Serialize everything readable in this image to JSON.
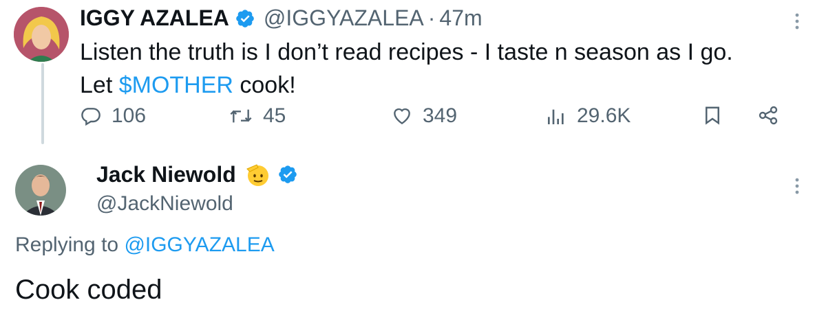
{
  "tweet": {
    "author_name": "IGGY AZALEA",
    "handle": "@IGGYAZALEA",
    "separator": "·",
    "time": "47m",
    "text_line1": "Listen the truth is I don’t read recipes - I taste n season as I go.",
    "text_line2_before": "Let ",
    "text_line2_link": "$MOTHER",
    "text_line2_after": " cook!",
    "stats": {
      "replies": "106",
      "retweets": "45",
      "likes": "349",
      "views": "29.6K"
    }
  },
  "reply": {
    "author_name": "Jack Niewold",
    "handle": "@JackNiewold",
    "replying_prefix": "Replying to ",
    "replying_handle": "@IGGYAZALEA",
    "text": "Cook coded"
  },
  "icons": {
    "reply": "speech-bubble-icon",
    "retweet": "retweet-icon",
    "like": "heart-icon",
    "views": "bar-chart-icon",
    "bookmark": "bookmark-icon",
    "share": "share-icon",
    "more": "more-vertical-icon",
    "verified": "verified-badge-icon",
    "emoji": "saluting-face-emoji"
  },
  "colors": {
    "link": "#1d9bf0",
    "secondary_text": "#536471",
    "verified": "#1d9bf0"
  }
}
